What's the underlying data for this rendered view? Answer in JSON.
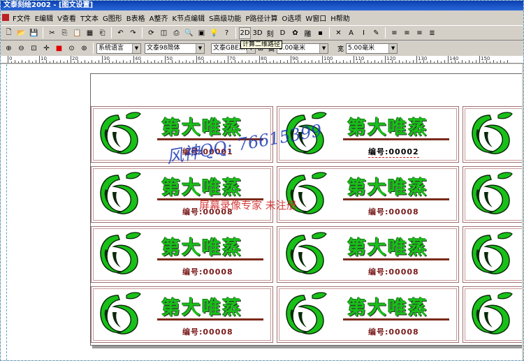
{
  "window": {
    "title": "文泰刻绘2002 - [图文设置]"
  },
  "menu": [
    {
      "key": "file",
      "label": "F文件"
    },
    {
      "key": "edit",
      "label": "E编辑"
    },
    {
      "key": "view",
      "label": "V查看"
    },
    {
      "key": "text",
      "label": "T文本"
    },
    {
      "key": "graphics",
      "label": "G图形"
    },
    {
      "key": "table",
      "label": "B表格"
    },
    {
      "key": "align",
      "label": "A整齐"
    },
    {
      "key": "node",
      "label": "K节点编辑"
    },
    {
      "key": "advanced",
      "label": "S高级功能"
    },
    {
      "key": "path",
      "label": "P路径计算"
    },
    {
      "key": "options",
      "label": "O选项"
    },
    {
      "key": "window",
      "label": "W窗口"
    },
    {
      "key": "help",
      "label": "H帮助"
    }
  ],
  "toolbar1": [
    {
      "icon": "new-icon",
      "glyph": "🗋"
    },
    {
      "icon": "open-icon",
      "glyph": "📂"
    },
    {
      "icon": "save-icon",
      "glyph": "💾"
    },
    {
      "sep": true
    },
    {
      "icon": "cut-icon",
      "glyph": "✂"
    },
    {
      "icon": "copy-icon",
      "glyph": "⎘"
    },
    {
      "icon": "paste-icon",
      "glyph": "📋"
    },
    {
      "icon": "grid-icon",
      "glyph": "▦"
    },
    {
      "icon": "special-paste-icon",
      "glyph": "⎗"
    },
    {
      "sep": true
    },
    {
      "icon": "undo-icon",
      "glyph": "↶"
    },
    {
      "icon": "redo-icon",
      "glyph": "↷"
    },
    {
      "sep": true
    },
    {
      "icon": "refresh-icon",
      "glyph": "⟳"
    },
    {
      "icon": "frame-icon",
      "glyph": "◫"
    },
    {
      "icon": "print-icon",
      "glyph": "⎙"
    },
    {
      "icon": "preview-icon",
      "glyph": "🔍"
    },
    {
      "icon": "image-icon",
      "glyph": "▣"
    },
    {
      "icon": "bulb-icon",
      "glyph": "💡"
    },
    {
      "icon": "help-icon",
      "glyph": "?"
    },
    {
      "sep": true
    },
    {
      "icon": "path2d-icon",
      "glyph": "2D",
      "active": true
    },
    {
      "icon": "path3d-icon",
      "glyph": "3D"
    },
    {
      "icon": "carve-icon",
      "glyph": "刻"
    },
    {
      "icon": "cut-plot-icon",
      "glyph": "D"
    },
    {
      "icon": "color-icon",
      "glyph": "✿"
    },
    {
      "icon": "engrave-icon",
      "glyph": "雕"
    },
    {
      "icon": "layer-icon",
      "glyph": "▪"
    },
    {
      "sep": true
    },
    {
      "icon": "node-icon",
      "glyph": "✕"
    },
    {
      "icon": "text-a-icon",
      "glyph": "A"
    },
    {
      "icon": "italic-icon",
      "glyph": "I"
    },
    {
      "icon": "edit-text-icon",
      "glyph": "✎"
    },
    {
      "sep": true
    },
    {
      "icon": "align-left-icon",
      "glyph": "≡"
    },
    {
      "icon": "align-center-icon",
      "glyph": "≡"
    },
    {
      "icon": "align-right-icon",
      "glyph": "≡"
    },
    {
      "icon": "justify-icon",
      "glyph": "≣"
    }
  ],
  "toolbar2": {
    "icons": [
      {
        "icon": "zoom-in-icon",
        "glyph": "⊕"
      },
      {
        "icon": "zoom-out-icon",
        "glyph": "⊖"
      },
      {
        "icon": "zoom-select-icon",
        "glyph": "⊡"
      },
      {
        "icon": "crosshair-icon",
        "glyph": "✛"
      },
      {
        "icon": "stop-icon",
        "glyph": "■"
      },
      {
        "icon": "zoom-page-icon",
        "glyph": "⊙"
      },
      {
        "icon": "zoom-all-icon",
        "glyph": "⊚"
      }
    ],
    "language": "系统语言",
    "font_cn": "文泰98简体",
    "font_en": "文泰GBE黑体",
    "height_label": "高",
    "height_value": "5.00毫米",
    "width_label": "宽",
    "width_value": "5.00毫米"
  },
  "tooltip": "计算二维路径",
  "ruler": [
    "0",
    "10",
    "20",
    "30",
    "40",
    "50",
    "60",
    "70",
    "80",
    "90",
    "100",
    "110",
    "120",
    "130",
    "140",
    "150"
  ],
  "labels": {
    "brand": "第大唯蒸",
    "serial_prefix": "编号:",
    "rows": [
      [
        "00001",
        "00002",
        ""
      ],
      [
        "00008",
        "00008",
        ""
      ],
      [
        "00008",
        "00008",
        ""
      ],
      [
        "00008",
        "00008",
        ""
      ]
    ]
  },
  "watermarks": {
    "qq": "风神QQ: 76615399",
    "recorder": "屏幕录像专家 未注册"
  },
  "colors": {
    "logo_green": "#18c018",
    "logo_dark": "#0a2a0a",
    "serial_red": "#7a1a1a"
  }
}
